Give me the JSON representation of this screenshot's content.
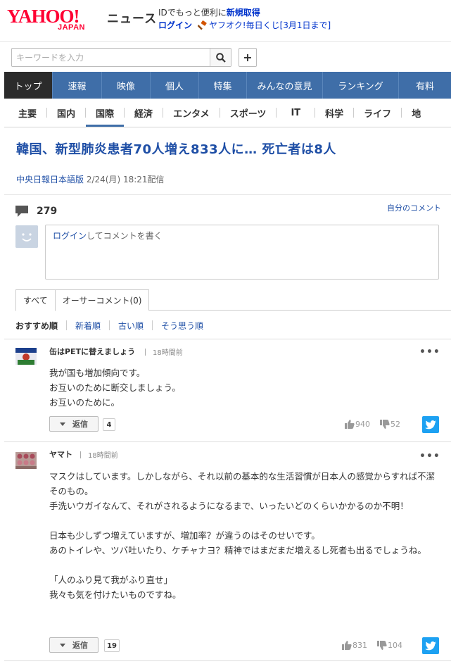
{
  "header": {
    "logo_text": "YAHOO!",
    "logo_sub": "JAPAN",
    "service_name": "ニュース",
    "promo_line1_prefix": "IDでもっと便利に",
    "promo_line1_link": "新規取得",
    "login": "ログイン",
    "auction": "ヤフオク!毎日くじ[3月1日まで]"
  },
  "search": {
    "placeholder": "キーワードを入力",
    "plus_label": "+"
  },
  "category_nav": [
    {
      "label": "トップ",
      "active": true
    },
    {
      "label": "速報"
    },
    {
      "label": "映像"
    },
    {
      "label": "個人"
    },
    {
      "label": "特集"
    },
    {
      "label": "みんなの意見"
    },
    {
      "label": "ランキング"
    },
    {
      "label": "有料"
    }
  ],
  "sub_nav": [
    {
      "label": "主要"
    },
    {
      "label": "国内"
    },
    {
      "label": "国際",
      "active": true
    },
    {
      "label": "経済"
    },
    {
      "label": "エンタメ"
    },
    {
      "label": "スポーツ"
    },
    {
      "label": "IT"
    },
    {
      "label": "科学"
    },
    {
      "label": "ライフ"
    },
    {
      "label": "地"
    }
  ],
  "article": {
    "title": "韓国、新型肺炎患者70人増え833人に… 死亡者は8人",
    "source": "中央日報日本語版",
    "date": "2/24(月) 18:21配信"
  },
  "comments_header": {
    "count": "279",
    "my_comments": "自分のコメント",
    "login_link": "ログイン",
    "login_prompt": "してコメントを書く"
  },
  "tabs": [
    {
      "label": "すべて",
      "active": true
    },
    {
      "label": "オーサーコメント(0)"
    }
  ],
  "sort": [
    {
      "label": "おすすめ順",
      "active": true
    },
    {
      "label": "新着順"
    },
    {
      "label": "古い順"
    },
    {
      "label": "そう思う順"
    }
  ],
  "comments": [
    {
      "author": "缶はPETに替えましょう",
      "time": "18時間前",
      "body": "我が国も増加傾向です。\nお互いのために断交しましょう。\nお互いのために。",
      "reply_label": "返信",
      "reply_count": "4",
      "likes": "940",
      "dislikes": "52"
    },
    {
      "author": "ヤマト",
      "time": "18時間前",
      "body": "マスクはしています。しかしながら、それ以前の基本的な生活習慣が日本人の感覚からすれば不潔そのもの。\n手洗いウガイなんて、それがされるようになるまで、いったいどのくらいかかるのか不明！\n\n日本も少しずつ増えていますが、増加率？が違うのはそのせいです。\nあのトイレや、ツバ吐いたり、ケチャナヨ？精神ではまだまだ増えるし死者も出るでしょうね。\n\n「人のふり見て我がふり直せ」\n我々も気を付けたいものですね。",
      "reply_label": "返信",
      "reply_count": "19",
      "likes": "831",
      "dislikes": "104"
    }
  ],
  "colors": {
    "nav_blue": "#3f6ea8",
    "link_blue": "#1f4fa6",
    "yahoo_red": "#ff0033",
    "twitter": "#1da1f2"
  }
}
